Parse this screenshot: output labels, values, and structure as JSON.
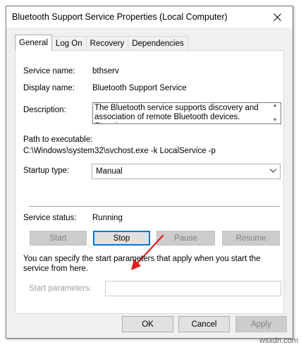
{
  "window": {
    "title": "Bluetooth Support Service Properties (Local Computer)"
  },
  "tabs": [
    {
      "label": "General",
      "active": true
    },
    {
      "label": "Log On"
    },
    {
      "label": "Recovery"
    },
    {
      "label": "Dependencies"
    }
  ],
  "general": {
    "service_name_label": "Service name:",
    "service_name_value": "bthserv",
    "display_name_label": "Display name:",
    "display_name_value": "Bluetooth Support Service",
    "description_label": "Description:",
    "description_value": "The Bluetooth service supports discovery and association of remote Bluetooth devices.  Stopping",
    "path_label": "Path to executable:",
    "path_value": "C:\\Windows\\system32\\svchost.exe -k LocalService -p",
    "startup_type_label": "Startup type:",
    "startup_type_value": "Manual",
    "service_status_label": "Service status:",
    "service_status_value": "Running",
    "buttons": {
      "start": "Start",
      "stop": "Stop",
      "pause": "Pause",
      "resume": "Resume"
    },
    "info_text": "You can specify the start parameters that apply when you start the service from here.",
    "start_params_label": "Start parameters:",
    "start_params_value": ""
  },
  "footer": {
    "ok": "OK",
    "cancel": "Cancel",
    "apply": "Apply"
  },
  "annotation": {
    "arrow_color": "#e21c1c",
    "focus_color": "#0078d7"
  },
  "watermark": "wsxdn.com"
}
